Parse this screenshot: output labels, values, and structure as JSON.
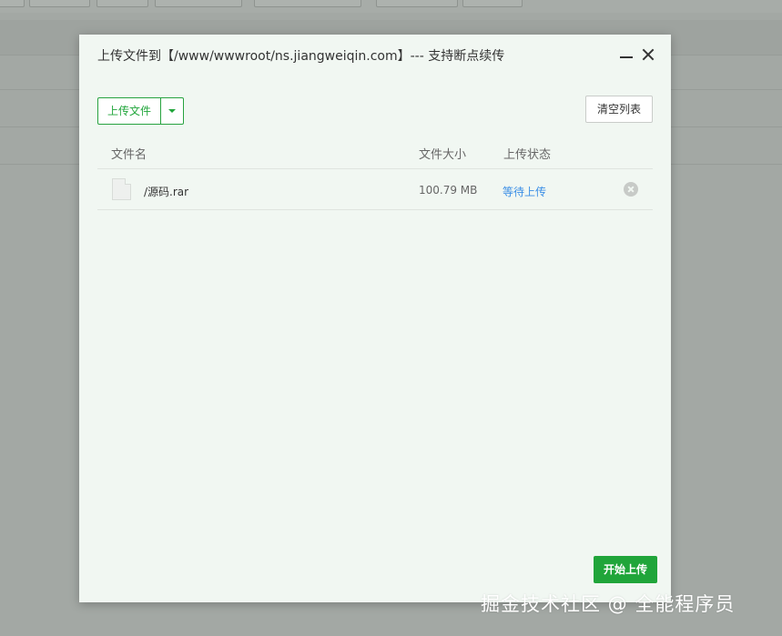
{
  "modal": {
    "title": "上传文件到【/www/wwwroot/ns.jiangweiqin.com】--- 支持断点续传",
    "upload_label": "上传文件",
    "clear_label": "清空列表",
    "start_label": "开始上传",
    "columns": {
      "name": "文件名",
      "size": "文件大小",
      "status": "上传状态"
    },
    "files": [
      {
        "name": "/源码.rar",
        "size": "100.79 MB",
        "status": "等待上传"
      }
    ]
  },
  "icons": {
    "minimize": "minimize-icon",
    "close": "close-icon",
    "dropdown": "caret-down-icon",
    "file": "file-icon",
    "remove": "remove-circle-icon"
  },
  "colors": {
    "accent": "#20a53a",
    "status_link": "#3a8ee6",
    "modal_bg": "#f1f7f2",
    "overlay": "#a3a8a4"
  },
  "watermark": "掘金技术社区 @ 全能程序员"
}
